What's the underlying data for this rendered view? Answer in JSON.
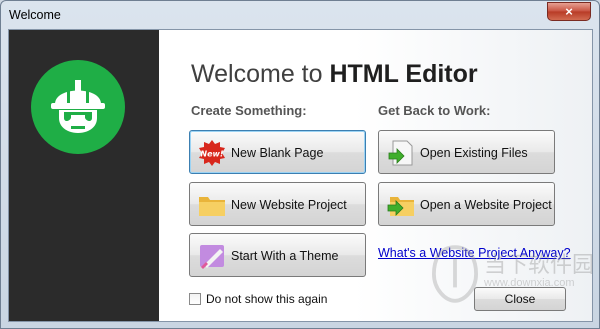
{
  "window": {
    "title": "Welcome",
    "close_glyph": "×"
  },
  "main": {
    "heading_prefix": "Welcome to ",
    "heading_app": "HTML Editor",
    "create_label": "Create Something:",
    "back_label": "Get Back to Work:"
  },
  "buttons": {
    "new_blank": "New Blank Page",
    "new_website": "New Website Project",
    "start_theme": "Start With a Theme",
    "open_existing": "Open Existing Files",
    "open_website": "Open a Website Project"
  },
  "badge": {
    "new": "New!"
  },
  "link": {
    "website_project": "What's a Website Project Anyway?"
  },
  "footer": {
    "checkbox_label": "Do not show this again",
    "checkbox_checked": false,
    "close_label": "Close"
  },
  "watermark": {
    "main": "当下软件园",
    "sub": "www.downxia.com"
  },
  "colors": {
    "sidebar": "#2b2b2b",
    "logo_green": "#1fae46",
    "link": "#0000cc"
  },
  "icons": [
    "helmet-logo",
    "new-badge-icon",
    "folder-icon",
    "theme-brush-icon",
    "open-file-arrow-icon",
    "open-folder-arrow-icon"
  ]
}
